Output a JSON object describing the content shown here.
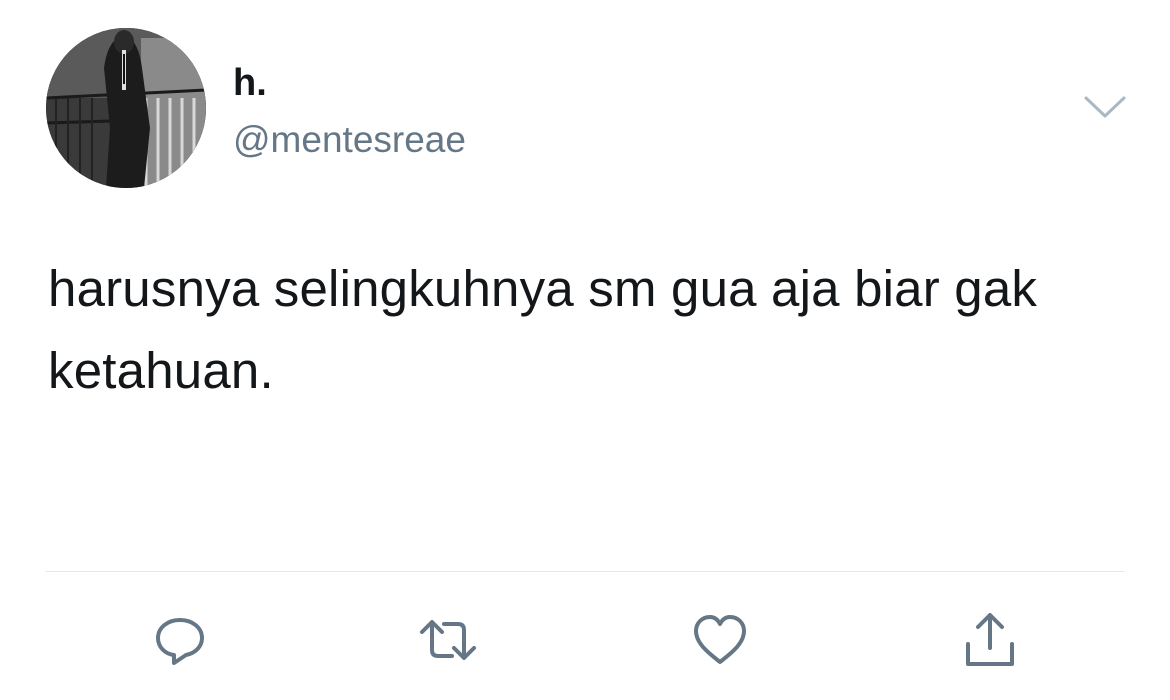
{
  "tweet": {
    "author": {
      "display_name": "h.",
      "handle": "@mentesreae",
      "avatar": "avatar-photo"
    },
    "text": "harusnya selingkuhnya sm gua aja biar gak ketahuan.",
    "menu_icon": "chevron-down-icon",
    "actions": [
      {
        "name": "reply",
        "icon": "reply-icon"
      },
      {
        "name": "retweet",
        "icon": "retweet-icon"
      },
      {
        "name": "like",
        "icon": "heart-icon"
      },
      {
        "name": "share",
        "icon": "share-icon"
      }
    ]
  },
  "colors": {
    "text": "#14171a",
    "secondary": "#657786",
    "icon": "#657786",
    "divider": "#e1e8ed"
  }
}
